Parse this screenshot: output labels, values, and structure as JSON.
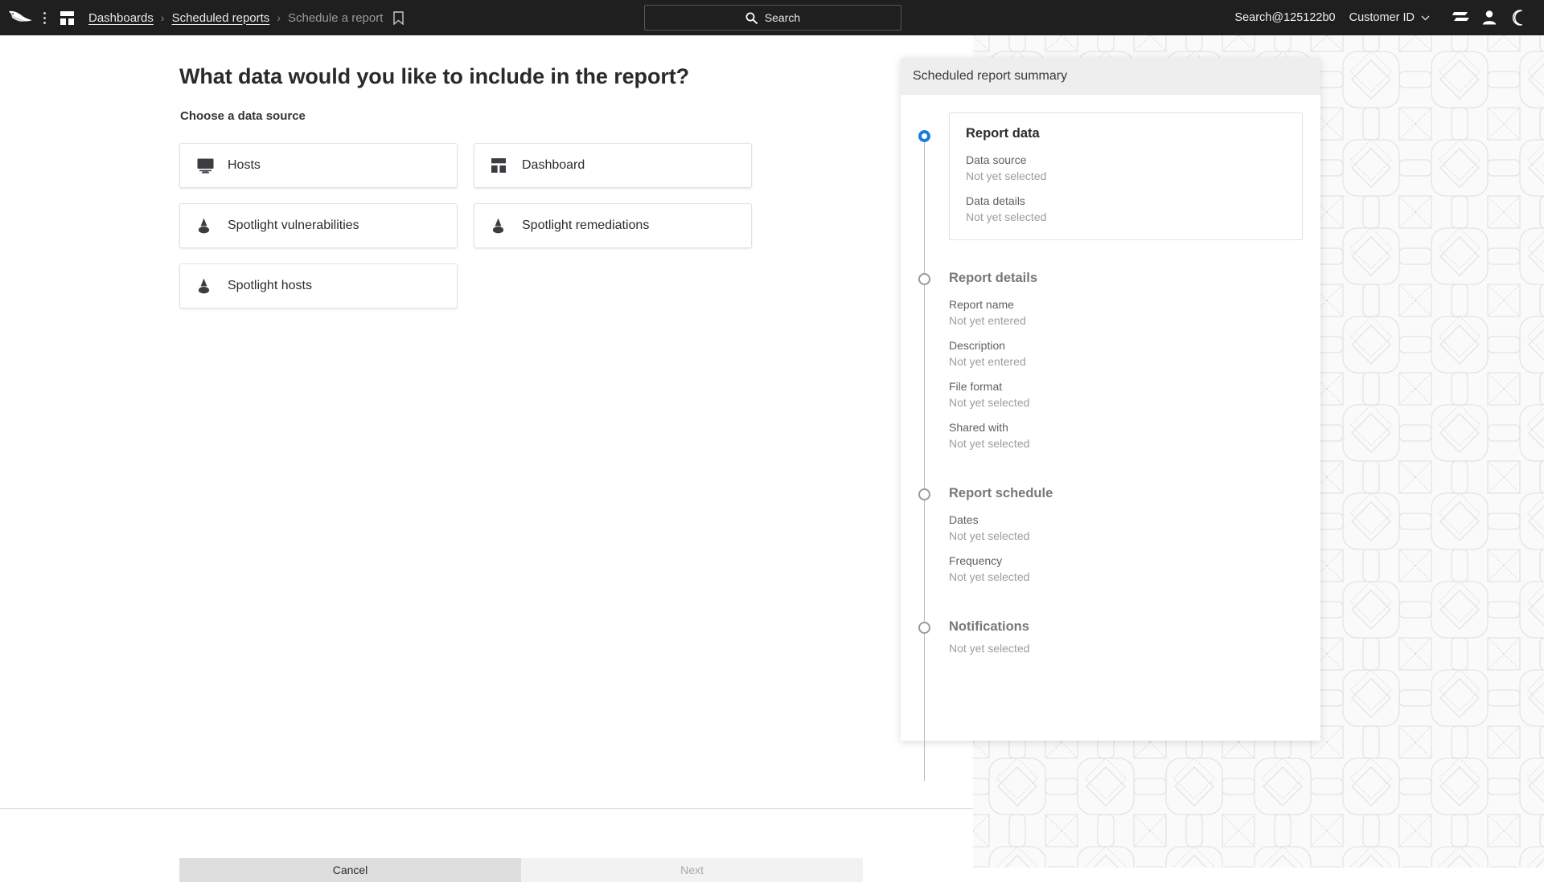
{
  "topbar": {
    "logo_icon": "falcon-logo",
    "menu_icon": "kebab-menu-icon",
    "apps_icon": "apps-grid-icon",
    "breadcrumbs": [
      {
        "label": "Dashboards",
        "current": false
      },
      {
        "label": "Scheduled reports",
        "current": false
      },
      {
        "label": "Schedule a report",
        "current": true
      }
    ],
    "separator": "›",
    "bookmark_icon": "bookmark-icon",
    "search": {
      "icon": "search-icon",
      "label": "Search",
      "placeholder": "Search"
    },
    "user": "Search@125122b0",
    "customer_id_label": "Customer ID",
    "customer_chevron_icon": "chevron-down-icon",
    "icons": [
      {
        "name": "support-lines-icon"
      },
      {
        "name": "user-account-icon"
      },
      {
        "name": "dark-mode-moon-icon"
      }
    ]
  },
  "main": {
    "title": "What data would you like to include in the report?",
    "section_label": "Choose a data source",
    "data_sources": [
      {
        "label": "Hosts",
        "icon": "monitor-icon"
      },
      {
        "label": "Dashboard",
        "icon": "dashboard-grid-icon"
      },
      {
        "label": "Spotlight vulnerabilities",
        "icon": "spotlight-icon"
      },
      {
        "label": "Spotlight remediations",
        "icon": "spotlight-icon"
      },
      {
        "label": "Spotlight hosts",
        "icon": "spotlight-icon"
      }
    ]
  },
  "footer": {
    "cancel_label": "Cancel",
    "next_label": "Next"
  },
  "summary": {
    "heading": "Scheduled report summary",
    "steps": [
      {
        "title": "Report data",
        "active": true,
        "boxed": true,
        "fields": [
          {
            "key": "Data source",
            "value": "Not yet selected"
          },
          {
            "key": "Data details",
            "value": "Not yet selected"
          }
        ]
      },
      {
        "title": "Report details",
        "active": false,
        "boxed": false,
        "fields": [
          {
            "key": "Report name",
            "value": "Not yet entered"
          },
          {
            "key": "Description",
            "value": "Not yet entered"
          },
          {
            "key": "File format",
            "value": "Not yet selected"
          },
          {
            "key": "Shared with",
            "value": "Not yet selected"
          }
        ]
      },
      {
        "title": "Report schedule",
        "active": false,
        "boxed": false,
        "fields": [
          {
            "key": "Dates",
            "value": "Not yet selected"
          },
          {
            "key": "Frequency",
            "value": "Not yet selected"
          }
        ]
      },
      {
        "title": "Notifications",
        "active": false,
        "boxed": false,
        "fields": [
          {
            "key": "",
            "value": "Not yet selected"
          }
        ]
      }
    ]
  },
  "colors": {
    "topbar_bg": "#1f1f1f",
    "accent_blue": "#1b7ed6",
    "panel_head_bg": "#eeeeee",
    "cancel_bg": "#dededf",
    "next_bg": "#f2f2f2"
  }
}
